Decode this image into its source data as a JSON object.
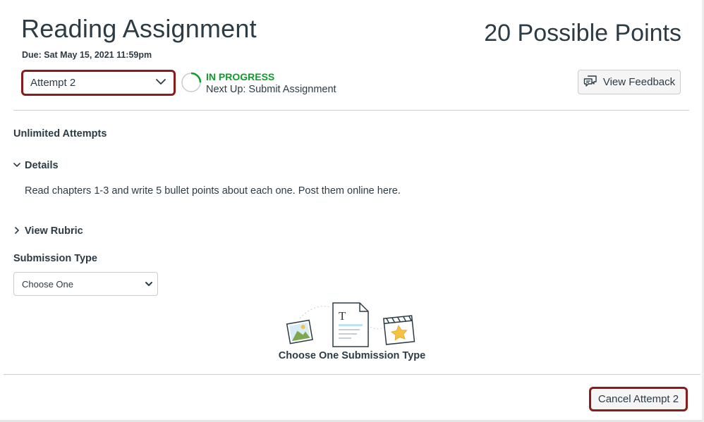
{
  "assignment": {
    "title": "Reading Assignment",
    "due": "Due: Sat May 15, 2021 11:59pm",
    "points": "20 Possible Points"
  },
  "attempt": {
    "selected": "Attempt 2",
    "status": "IN PROGRESS",
    "next_up": "Next Up: Submit Assignment",
    "progress_fraction": 0.25
  },
  "feedback_button": {
    "label": "View Feedback",
    "icon": "feedback-icon"
  },
  "attempts_info": "Unlimited Attempts",
  "details": {
    "heading": "Details",
    "text": "Read chapters 1-3 and write 5 bullet points about each one. Post them online here."
  },
  "rubric": {
    "heading": "View Rubric"
  },
  "submission": {
    "label": "Submission Type",
    "selected": "Choose One",
    "caption": "Choose One Submission Type"
  },
  "cancel_button": {
    "label": "Cancel Attempt 2"
  },
  "colors": {
    "status_green": "#0b9e2a",
    "highlight_red": "#8b1a1a",
    "text": "#2d3b45",
    "divider": "#c7cdd1"
  }
}
